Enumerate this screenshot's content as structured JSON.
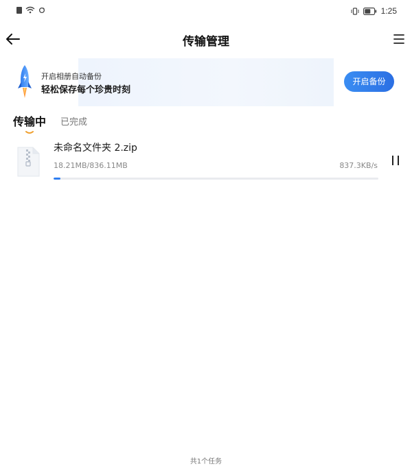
{
  "status_bar": {
    "time": "1:25",
    "icons": [
      "sim-icon",
      "wifi-icon",
      "sync-icon",
      "vibrate-icon",
      "battery-icon"
    ]
  },
  "header": {
    "title": "传输管理",
    "icons": [
      "back-arrow-icon",
      "menu-icon"
    ]
  },
  "banner": {
    "subtitle": "开启相册自动备份",
    "headline": "轻松保存每个珍贵时刻",
    "button_label": "开启备份",
    "icon": "rocket-icon"
  },
  "tabs": [
    {
      "label": "传输中",
      "active": true
    },
    {
      "label": "已完成",
      "active": false
    }
  ],
  "transfers": [
    {
      "name": "未命名文件夹 2.zip",
      "size": "18.21MB/836.11MB",
      "speed": "837.3KB/s",
      "progress": 0.022,
      "icon": "zip-file-icon",
      "action_icon": "pause-icon"
    }
  ],
  "footer": {
    "count_text": "共1个任务"
  },
  "colors": {
    "accent": "#2f7ef0",
    "banner_bg": "#eef4fd",
    "tab_indicator": "#f0a030"
  }
}
